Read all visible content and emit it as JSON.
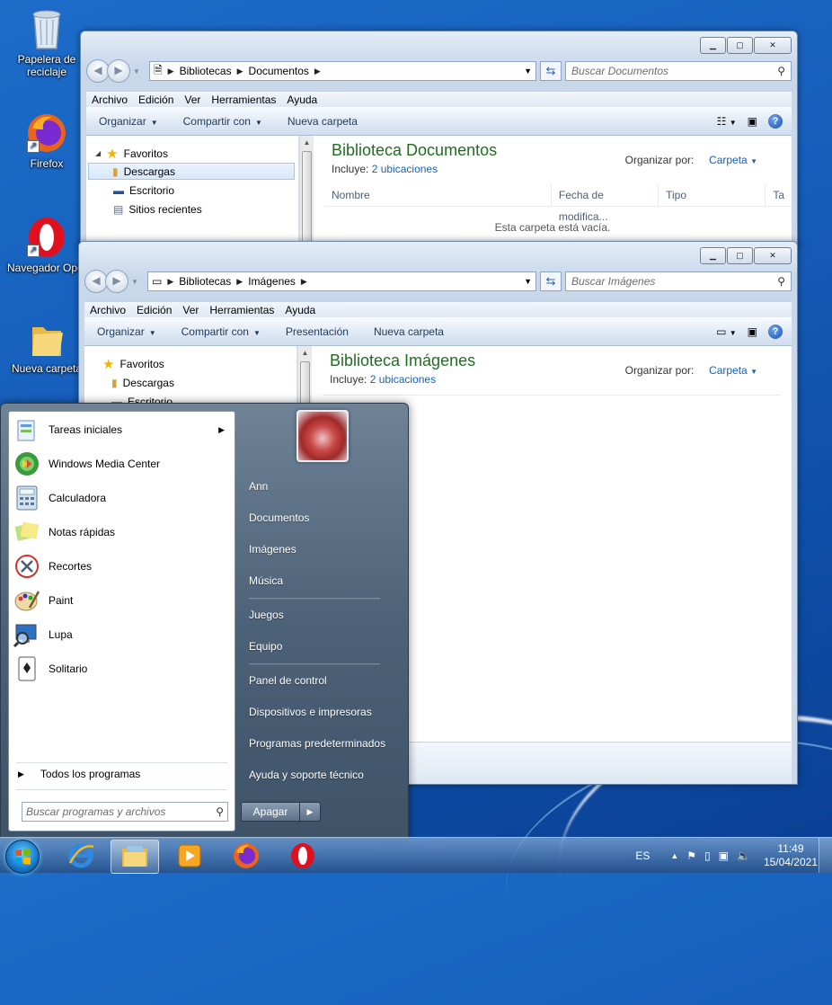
{
  "desktop": {
    "icons": [
      {
        "label": "Papelera de reciclaje",
        "icon": "recycle-bin-icon"
      },
      {
        "label": "Firefox",
        "icon": "firefox-icon"
      },
      {
        "label": "Navegador Opera",
        "icon": "opera-icon"
      },
      {
        "label": "Nueva carpeta",
        "icon": "folder-icon"
      }
    ]
  },
  "win_docs": {
    "breadcrumb": [
      "Bibliotecas",
      "Documentos"
    ],
    "search_placeholder": "Buscar Documentos",
    "menu": [
      "Archivo",
      "Edición",
      "Ver",
      "Herramientas",
      "Ayuda"
    ],
    "toolbar": {
      "organize": "Organizar",
      "share": "Compartir con",
      "new_folder": "Nueva carpeta"
    },
    "nav": {
      "favorites": "Favoritos",
      "items": [
        "Descargas",
        "Escritorio",
        "Sitios recientes"
      ]
    },
    "library_title": "Biblioteca Documentos",
    "includes_label": "Incluye:",
    "includes_link": "2 ubicaciones",
    "arrange_label": "Organizar por:",
    "arrange_value": "Carpeta",
    "columns": [
      "Nombre",
      "Fecha de modifica...",
      "Tipo",
      "Ta"
    ],
    "empty_text": "Esta carpeta está vacía."
  },
  "win_images": {
    "breadcrumb": [
      "Bibliotecas",
      "Imágenes"
    ],
    "search_placeholder": "Buscar Imágenes",
    "menu": [
      "Archivo",
      "Edición",
      "Ver",
      "Herramientas",
      "Ayuda"
    ],
    "toolbar": {
      "organize": "Organizar",
      "share": "Compartir con",
      "slideshow": "Presentación",
      "new_folder": "Nueva carpeta"
    },
    "nav": {
      "favorites": "Favoritos",
      "items": [
        "Descargas",
        "Escritorio"
      ]
    },
    "library_title": "Biblioteca Imágenes",
    "includes_label": "Incluye:",
    "includes_link": "2 ubicaciones",
    "arrange_label": "Organizar por:",
    "arrange_value": "Carpeta"
  },
  "start_menu": {
    "programs": [
      {
        "label": "Tareas iniciales",
        "icon": "getting-started-icon"
      },
      {
        "label": "Windows Media Center",
        "icon": "media-center-icon"
      },
      {
        "label": "Calculadora",
        "icon": "calculator-icon"
      },
      {
        "label": "Notas rápidas",
        "icon": "sticky-notes-icon"
      },
      {
        "label": "Recortes",
        "icon": "snipping-tool-icon"
      },
      {
        "label": "Paint",
        "icon": "paint-icon"
      },
      {
        "label": "Lupa",
        "icon": "magnifier-icon"
      },
      {
        "label": "Solitario",
        "icon": "solitaire-icon"
      }
    ],
    "all_programs": "Todos los programas",
    "search_placeholder": "Buscar programas y archivos",
    "right_links": [
      "Ann",
      "Documentos",
      "Imágenes",
      "Música",
      "Juegos",
      "Equipo",
      "Panel de control",
      "Dispositivos e impresoras",
      "Programas predeterminados",
      "Ayuda y soporte técnico"
    ],
    "shutdown_label": "Apagar"
  },
  "taskbar": {
    "pinned": [
      "internet-explorer-icon",
      "explorer-icon",
      "media-player-icon",
      "firefox-icon",
      "opera-icon"
    ],
    "language": "ES",
    "time": "11:49",
    "date": "15/04/2021"
  }
}
